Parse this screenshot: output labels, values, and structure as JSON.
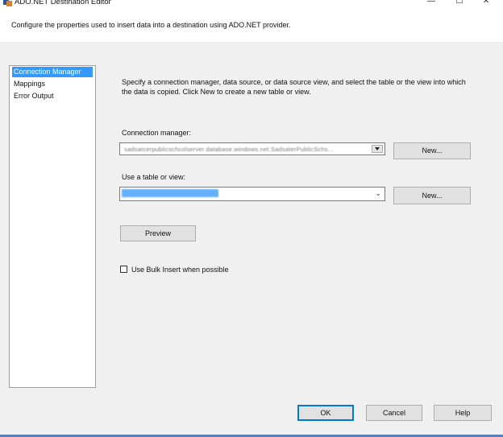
{
  "window": {
    "title": "ADO.NET Destination Editor",
    "minimize_glyph": "—",
    "maximize_glyph": "☐",
    "close_glyph": "✕"
  },
  "description": "Configure the properties used to insert data into a destination using ADO.NET provider.",
  "pages": [
    {
      "label": "Connection Manager",
      "selected": true
    },
    {
      "label": "Mappings",
      "selected": false
    },
    {
      "label": "Error Output",
      "selected": false
    }
  ],
  "connection_panel": {
    "instructions": "Specify a connection manager, data source, or data source view, and select the table or the view into which the data is copied. Click New to create a new table or view.",
    "connection_manager_label": "Connection manager:",
    "connection_manager_value": "sadsatcerpublicschcolserver.database.windows.net.SadsaterPublicSchs...",
    "connection_new_label": "New...",
    "table_label": "Use a table or view:",
    "table_new_label": "New...",
    "preview_label": "Preview",
    "bulk_insert_label": "Use Bulk Insert when possible",
    "bulk_insert_checked": false
  },
  "footer": {
    "ok_label": "OK",
    "cancel_label": "Cancel",
    "help_label": "Help"
  },
  "colors": {
    "selection": "#3399ff",
    "default_button_border": "#0078d7",
    "dialog_background": "#f0f0f0"
  }
}
